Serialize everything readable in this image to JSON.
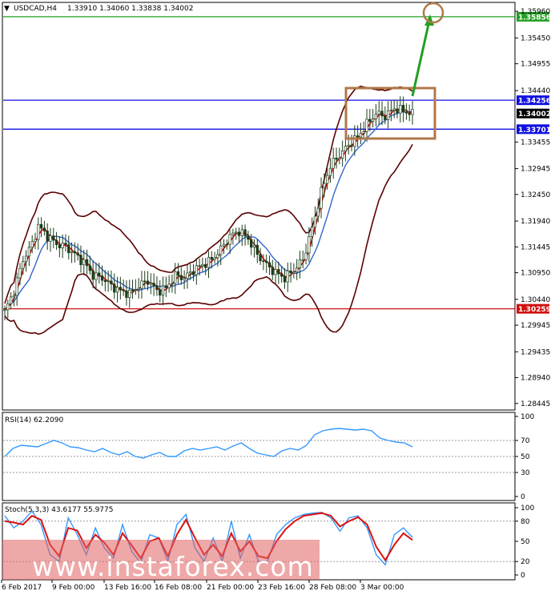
{
  "chart_data": [
    {
      "type": "candlestick",
      "title": "USDCAD,H4",
      "ohlc_header": "1.33910 1.34060 1.33838 1.34002",
      "price_ticks": [
        "1.35960",
        "1.35450",
        "1.34955",
        "1.34440",
        "1.33455",
        "1.32945",
        "1.32450",
        "1.31940",
        "1.31445",
        "1.30950",
        "1.30440",
        "1.29945",
        "1.29435",
        "1.28940",
        "1.28445"
      ],
      "x_ticks": [
        "6 Feb 2017",
        "9 Feb 00:00",
        "13 Feb 16:00",
        "16 Feb 08:00",
        "21 Feb 00:00",
        "23 Feb 16:00",
        "28 Feb 08:00",
        "3 Mar 00:00"
      ],
      "ylim": [
        1.2835,
        1.361
      ],
      "close_path": [
        [
          0,
          1.302
        ],
        [
          3,
          1.306
        ],
        [
          6,
          1.312
        ],
        [
          9,
          1.315
        ],
        [
          11,
          1.3185
        ],
        [
          14,
          1.3165
        ],
        [
          17,
          1.315
        ],
        [
          20,
          1.3145
        ],
        [
          23,
          1.313
        ],
        [
          26,
          1.3115
        ],
        [
          29,
          1.309
        ],
        [
          32,
          1.3085
        ],
        [
          35,
          1.307
        ],
        [
          38,
          1.306
        ],
        [
          41,
          1.3055
        ],
        [
          44,
          1.307
        ],
        [
          47,
          1.308
        ],
        [
          50,
          1.306
        ],
        [
          53,
          1.3065
        ],
        [
          56,
          1.309
        ],
        [
          59,
          1.3085
        ],
        [
          62,
          1.31
        ],
        [
          65,
          1.311
        ],
        [
          68,
          1.312
        ],
        [
          71,
          1.314
        ],
        [
          74,
          1.3165
        ],
        [
          77,
          1.3175
        ],
        [
          80,
          1.316
        ],
        [
          83,
          1.313
        ],
        [
          86,
          1.311
        ],
        [
          89,
          1.3095
        ],
        [
          92,
          1.3085
        ],
        [
          95,
          1.31
        ],
        [
          98,
          1.312
        ],
        [
          101,
          1.318
        ],
        [
          104,
          1.325
        ],
        [
          107,
          1.33
        ],
        [
          110,
          1.332
        ],
        [
          113,
          1.334
        ],
        [
          116,
          1.3355
        ],
        [
          119,
          1.338
        ],
        [
          122,
          1.34
        ],
        [
          125,
          1.3395
        ],
        [
          128,
          1.341
        ],
        [
          131,
          1.3405
        ],
        [
          134,
          1.34
        ]
      ],
      "levels": [
        {
          "label": "1.35856",
          "value": 1.35856,
          "color": "#22a022"
        },
        {
          "label": "1.34256",
          "value": 1.34256,
          "color": "#1010e0"
        },
        {
          "label": "1.33701",
          "value": 1.33701,
          "color": "#1010e0"
        },
        {
          "label": "1.30259",
          "value": 1.30259,
          "color": "#d01010"
        }
      ],
      "current": {
        "label": "1.34002",
        "value": 1.34002
      }
    },
    {
      "type": "line",
      "title": "RSI(14) 62.2090",
      "ticks": [
        "100",
        "70",
        "50",
        "30",
        "0"
      ],
      "ylim": [
        0,
        100
      ],
      "values": [
        50,
        60,
        64,
        63,
        62,
        66,
        70,
        67,
        62,
        61,
        58,
        56,
        60,
        55,
        52,
        56,
        50,
        48,
        52,
        55,
        50,
        50,
        57,
        60,
        58,
        60,
        62,
        58,
        63,
        67,
        60,
        54,
        52,
        50,
        57,
        60,
        58,
        64,
        77,
        82,
        84,
        85,
        84,
        83,
        84,
        82,
        73,
        70,
        68,
        67,
        62
      ]
    },
    {
      "type": "line",
      "title": "Stoch(5,3,3) 43.6177 55.9775",
      "ticks": [
        "100",
        "80",
        "50",
        "20",
        "0"
      ],
      "ylim": [
        0,
        100
      ],
      "series": [
        {
          "values": [
            88,
            70,
            80,
            95,
            75,
            30,
            20,
            85,
            60,
            30,
            70,
            40,
            25,
            75,
            35,
            18,
            60,
            55,
            20,
            75,
            90,
            40,
            20,
            55,
            20,
            80,
            25,
            60,
            20,
            20,
            60,
            75,
            85,
            90,
            92,
            93,
            85,
            65,
            85,
            88,
            70,
            30,
            15,
            60,
            70,
            56
          ]
        },
        {
          "values": [
            80,
            78,
            75,
            88,
            82,
            45,
            28,
            70,
            66,
            40,
            60,
            48,
            30,
            62,
            44,
            25,
            50,
            55,
            28,
            60,
            82,
            55,
            30,
            45,
            28,
            62,
            35,
            50,
            28,
            25,
            50,
            68,
            80,
            88,
            90,
            92,
            88,
            72,
            80,
            86,
            75,
            42,
            22,
            45,
            62,
            52
          ]
        }
      ]
    }
  ],
  "watermark": "www.instaforex.com",
  "colors": {
    "bull": "#1a3d1a",
    "bear": "#1a3d1a",
    "ma_fast": "#d01010",
    "ma_slow": "#3366cc",
    "band": "#5a0000",
    "box": "#b07848",
    "arrow": "#22a022"
  }
}
